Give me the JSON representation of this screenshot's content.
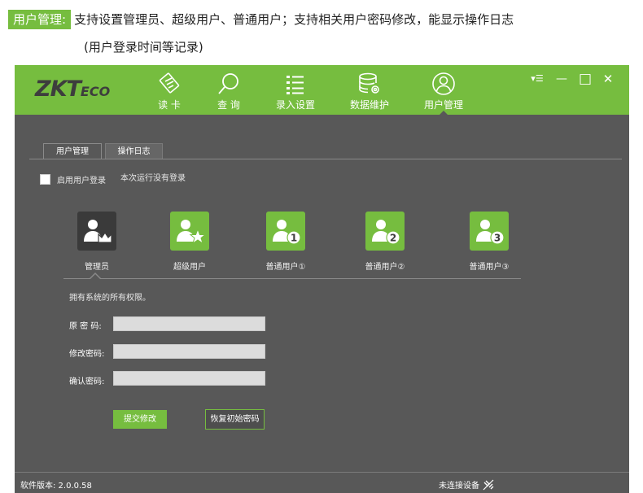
{
  "caption": {
    "badge": "用户管理:",
    "line1": "支持设置管理员、超级用户、普通用户；支持相关用户密码修改，能显示操作日志",
    "line2": "(用户登录时间等记录)"
  },
  "app": {
    "logo_main": "ZKT",
    "logo_small": "ECO",
    "nav": [
      {
        "label": "读  卡",
        "icon": "card-reader-icon"
      },
      {
        "label": "查  询",
        "icon": "search-icon"
      },
      {
        "label": "录入设置",
        "icon": "list-settings-icon"
      },
      {
        "label": "数据维护",
        "icon": "database-gear-icon"
      },
      {
        "label": "用户管理",
        "icon": "user-icon",
        "active": true
      }
    ],
    "window_controls": {
      "menu": "▾☰",
      "minimize": "—",
      "maximize": "□",
      "close": "✕"
    },
    "tabs": [
      {
        "label": "用户管理",
        "active": true
      },
      {
        "label": "操作日志",
        "active": false
      }
    ],
    "enable_login_label": "启用用户登录",
    "login_note": "本次运行没有登录",
    "user_types": [
      {
        "label": "管理员",
        "icon": "admin-crown-icon",
        "selected": true
      },
      {
        "label": "超级用户",
        "icon": "super-user-star-icon"
      },
      {
        "label": "普通用户①",
        "icon": "user-1-icon"
      },
      {
        "label": "普通用户②",
        "icon": "user-2-icon"
      },
      {
        "label": "普通用户③",
        "icon": "user-3-icon"
      }
    ],
    "permission_text": "拥有系统的所有权限。",
    "fields": {
      "old_password_label": "原 密 码:",
      "new_password_label": "修改密码:",
      "confirm_password_label": "确认密码:",
      "old_password_value": "",
      "new_password_value": "",
      "confirm_password_value": ""
    },
    "buttons": {
      "submit": "提交修改",
      "reset": "恢复初始密码"
    },
    "status": {
      "version": "软件版本: 2.0.0.58",
      "device": "未连接设备"
    },
    "colors": {
      "accent": "#76bd3f",
      "background": "#585858"
    }
  }
}
